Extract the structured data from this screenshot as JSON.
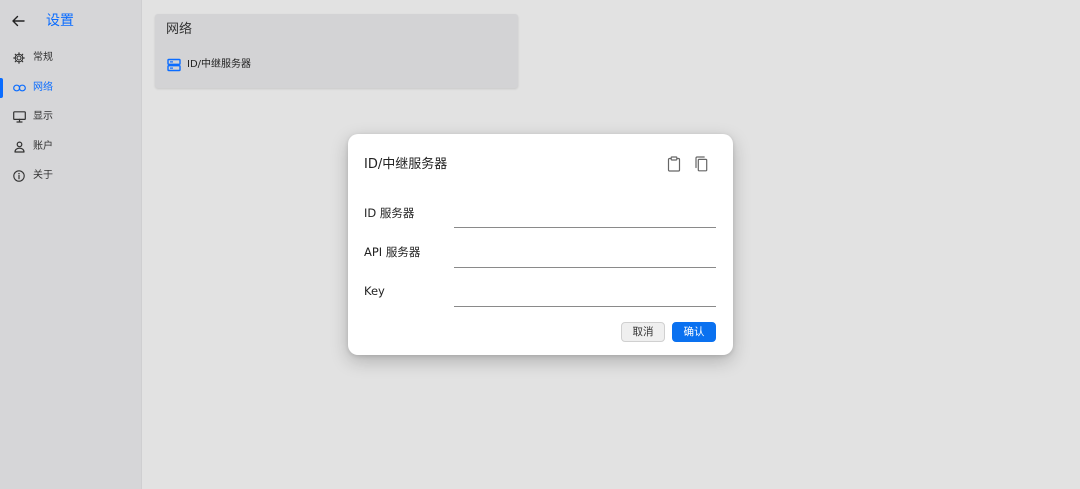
{
  "sidebar": {
    "title": "设置",
    "items": [
      {
        "label": "常规",
        "icon": "gear-icon"
      },
      {
        "label": "网络",
        "icon": "link-icon",
        "active": true
      },
      {
        "label": "显示",
        "icon": "monitor-icon"
      },
      {
        "label": "账户",
        "icon": "person-icon"
      },
      {
        "label": "关于",
        "icon": "info-icon"
      }
    ]
  },
  "network": {
    "title": "网络",
    "row_label": "ID/中继服务器"
  },
  "dialog": {
    "title": "ID/中继服务器",
    "fields": [
      {
        "label": "ID 服务器",
        "value": ""
      },
      {
        "label": "API 服务器",
        "value": ""
      },
      {
        "label": "Key",
        "value": ""
      }
    ],
    "cancel_label": "取消",
    "ok_label": "确认"
  },
  "colors": {
    "accent": "#0a6cff",
    "background": "#e2e2e2",
    "sidebar": "#d6d6d8",
    "dialog": "#ffffff"
  }
}
